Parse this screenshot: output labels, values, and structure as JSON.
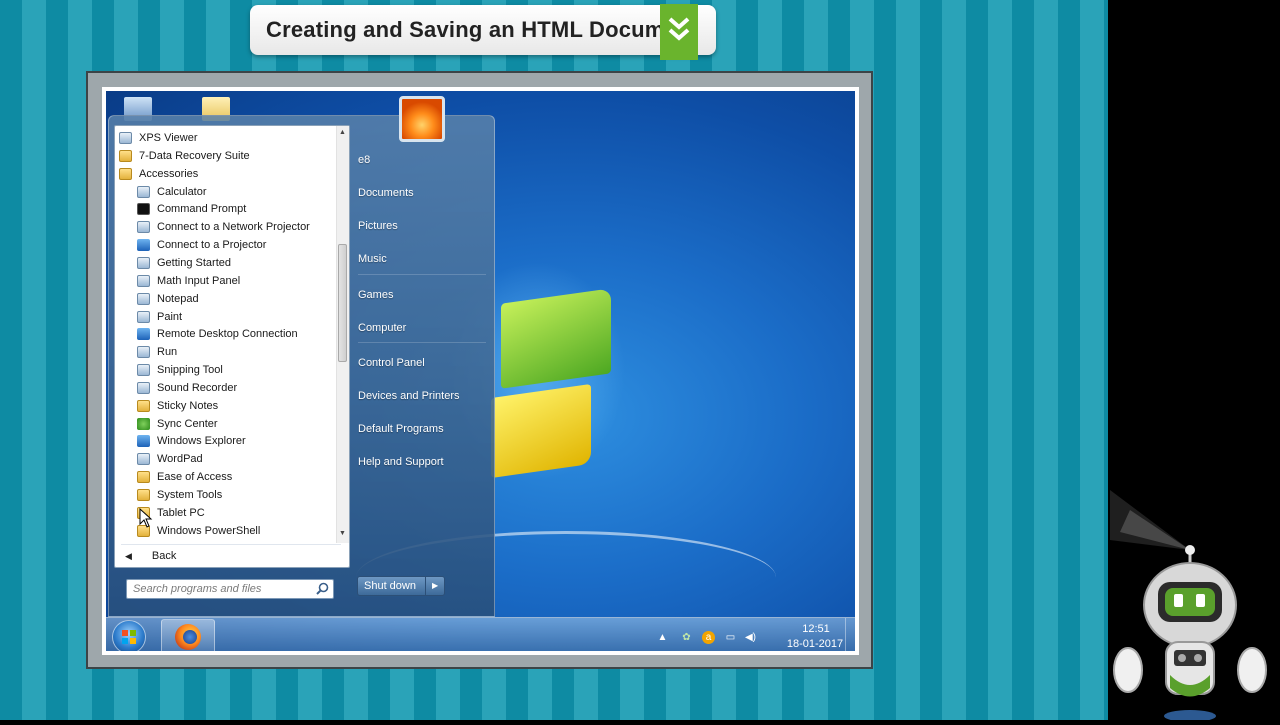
{
  "banner": {
    "title": "Creating and Saving an HTML Document",
    "icon": "double-chevron-down-icon",
    "accent": "#6ab42d"
  },
  "start_menu": {
    "programs": [
      {
        "label": "XPS Viewer",
        "icon": "app",
        "level": 0
      },
      {
        "label": "7-Data Recovery Suite",
        "icon": "folder",
        "level": 0
      },
      {
        "label": "Accessories",
        "icon": "folder",
        "level": 0
      },
      {
        "label": "Calculator",
        "icon": "app",
        "level": 1
      },
      {
        "label": "Command Prompt",
        "icon": "cmd",
        "level": 1
      },
      {
        "label": "Connect to a Network Projector",
        "icon": "app",
        "level": 1
      },
      {
        "label": "Connect to a Projector",
        "icon": "blue",
        "level": 1
      },
      {
        "label": "Getting Started",
        "icon": "app",
        "level": 1
      },
      {
        "label": "Math Input Panel",
        "icon": "app",
        "level": 1
      },
      {
        "label": "Notepad",
        "icon": "app",
        "level": 1
      },
      {
        "label": "Paint",
        "icon": "app",
        "level": 1
      },
      {
        "label": "Remote Desktop Connection",
        "icon": "blue",
        "level": 1
      },
      {
        "label": "Run",
        "icon": "app",
        "level": 1
      },
      {
        "label": "Snipping Tool",
        "icon": "app",
        "level": 1
      },
      {
        "label": "Sound Recorder",
        "icon": "app",
        "level": 1
      },
      {
        "label": "Sticky Notes",
        "icon": "folder",
        "level": 1
      },
      {
        "label": "Sync Center",
        "icon": "green",
        "level": 1
      },
      {
        "label": "Windows Explorer",
        "icon": "blue",
        "level": 1
      },
      {
        "label": "WordPad",
        "icon": "app",
        "level": 1
      },
      {
        "label": "Ease of Access",
        "icon": "folder",
        "level": 1
      },
      {
        "label": "System Tools",
        "icon": "folder",
        "level": 1
      },
      {
        "label": "Tablet PC",
        "icon": "folder",
        "level": 1
      },
      {
        "label": "Windows PowerShell",
        "icon": "folder",
        "level": 1
      }
    ],
    "back_label": "Back",
    "search_placeholder": "Search programs and files",
    "right_items": [
      "e8",
      "Documents",
      "Pictures",
      "Music",
      "Games",
      "Computer",
      "Control Panel",
      "Devices and Printers",
      "Default Programs",
      "Help and Support"
    ],
    "shutdown_label": "Shut down"
  },
  "taskbar": {
    "clock_time": "12:51",
    "clock_date": "18-01-2017",
    "pinned": [
      "firefox-icon"
    ]
  }
}
